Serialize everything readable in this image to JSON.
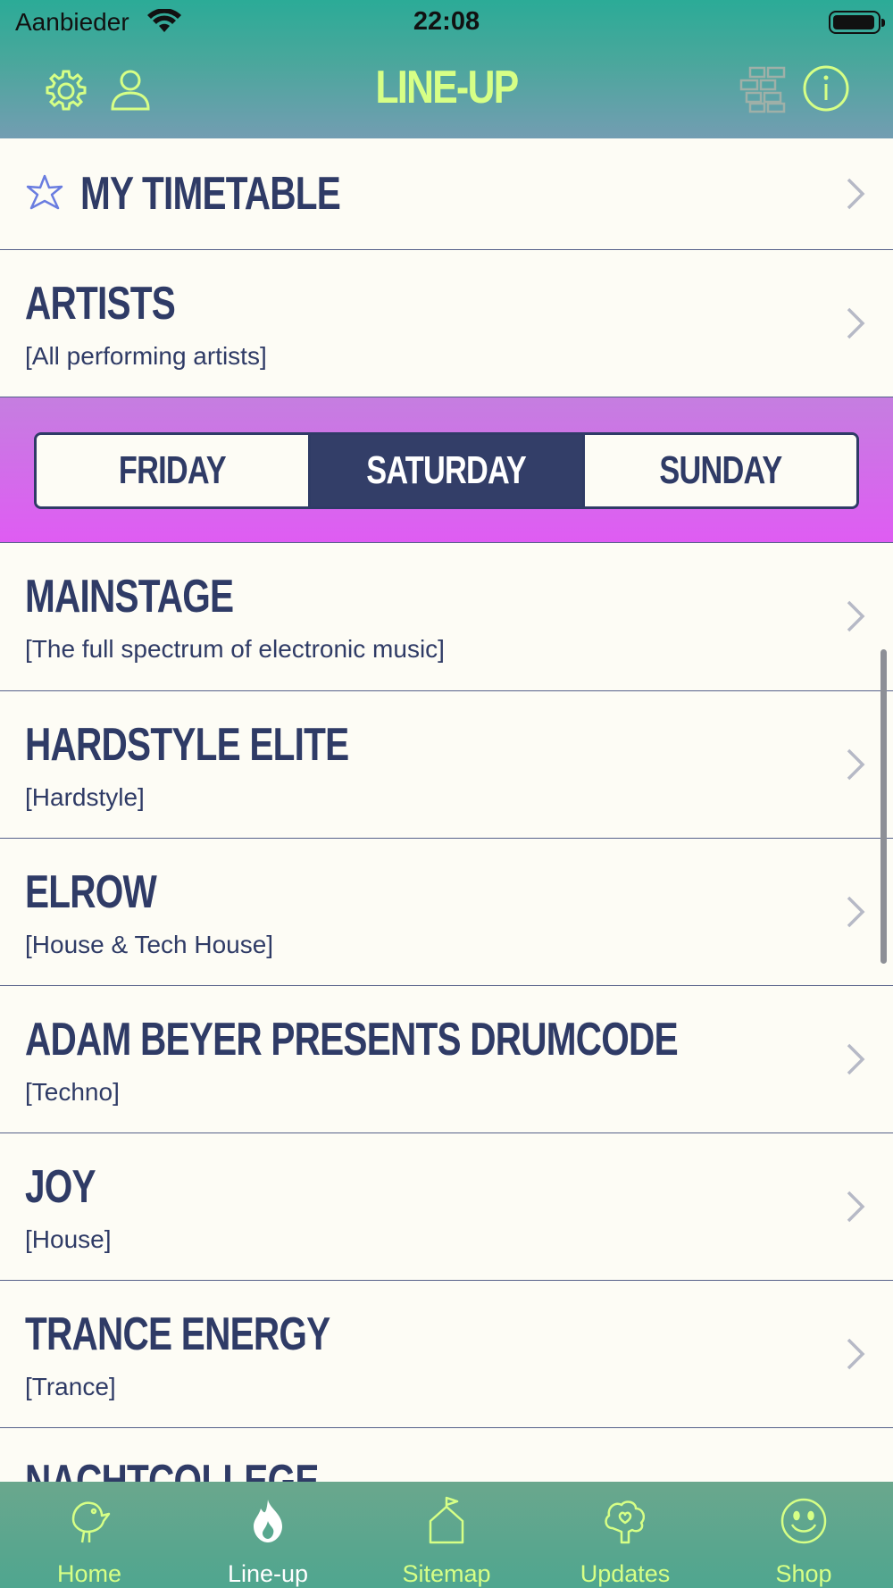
{
  "status_bar": {
    "carrier": "Aanbieder",
    "time": "22:08"
  },
  "header": {
    "title": "LINE-UP"
  },
  "my_timetable": {
    "title": "MY TIMETABLE"
  },
  "artists": {
    "title": "ARTISTS",
    "subtitle": "[All performing artists]"
  },
  "day_selector": {
    "days": [
      "FRIDAY",
      "SATURDAY",
      "SUNDAY"
    ],
    "selected": "SATURDAY"
  },
  "stages": [
    {
      "name": "MAINSTAGE",
      "genre": "[The full spectrum of electronic music]"
    },
    {
      "name": "HARDSTYLE ELITE",
      "genre": "[Hardstyle]"
    },
    {
      "name": "ELROW",
      "genre": "[House & Tech House]"
    },
    {
      "name": "ADAM BEYER PRESENTS DRUMCODE",
      "genre": "[Techno]"
    },
    {
      "name": "JOY",
      "genre": "[House]"
    },
    {
      "name": "TRANCE ENERGY",
      "genre": "[Trance]"
    },
    {
      "name": "NACHTCOLLEGE",
      "genre": ""
    }
  ],
  "tabbar": {
    "items": [
      {
        "label": "Home",
        "icon": "bird-icon"
      },
      {
        "label": "Line-up",
        "icon": "flame-icon"
      },
      {
        "label": "Sitemap",
        "icon": "flag-house-icon"
      },
      {
        "label": "Updates",
        "icon": "heart-tree-icon"
      },
      {
        "label": "Shop",
        "icon": "smiley-icon"
      }
    ],
    "active": "Line-up"
  },
  "colors": {
    "header_gradient": [
      "#2bab97",
      "#739db2"
    ],
    "accent_lime": "#d6ff86",
    "navy": "#2f3b66",
    "day_band_gradient": [
      "#c57ee0",
      "#df5cf3"
    ],
    "background": "#fdfcf5"
  }
}
